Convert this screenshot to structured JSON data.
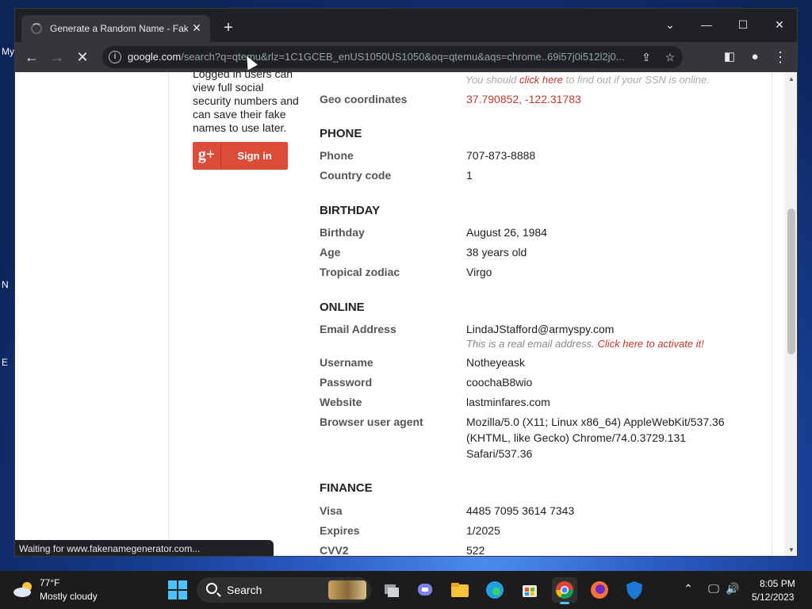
{
  "browser": {
    "tab_title": "Generate a Random Name - Fake Name Generator",
    "newtab": "+",
    "minimize": "—",
    "maximize": "☐",
    "close": "✕",
    "tab_dropdown": "⌄",
    "url_host": "google.com",
    "url_rest": "/search?q=qtemu&rlz=1C1GCEB_enUS1050US1050&oq=qtemu&aqs=chrome..69i57j0i512l2j0...",
    "status": "Waiting for www.fakenamegenerator.com..."
  },
  "sidebar": {
    "text": "Logged in users can view full social security numbers and can save their fake names to use later.",
    "signin": "Sign in",
    "gplus": "g+"
  },
  "top_note": {
    "text": "You should ",
    "link": "click here",
    "rest": " to find out if your SSN is online."
  },
  "rows": {
    "geo_label": "Geo coordinates",
    "geo_value": "37.790852, -122.31783",
    "phone_head": "PHONE",
    "phone_label": "Phone",
    "phone_value": "707-873-8888",
    "cc_label": "Country code",
    "cc_value": "1",
    "birthday_head": "BIRTHDAY",
    "bday_label": "Birthday",
    "bday_value": "August 26, 1984",
    "age_label": "Age",
    "age_value": "38 years old",
    "zodiac_label": "Tropical zodiac",
    "zodiac_value": "Virgo",
    "online_head": "ONLINE",
    "email_label": "Email Address",
    "email_value": "LindaJStafford@armyspy.com",
    "email_note": "This is a real email address. ",
    "email_link": "Click here to activate it!",
    "user_label": "Username",
    "user_value": "Notheyeask",
    "pass_label": "Password",
    "pass_value": "coochaB8wio",
    "web_label": "Website",
    "web_value": "lastminfares.com",
    "ua_label": "Browser user agent",
    "ua_line1": "Mozilla/5.0 (X11; Linux x86_64) AppleWebKit/537.36",
    "ua_line2": "(KHTML, like Gecko) Chrome/74.0.3729.131",
    "ua_line3": "Safari/537.36",
    "finance_head": "FINANCE",
    "visa_label": "Visa",
    "visa_value": "4485 7095 3614 7343",
    "exp_label": "Expires",
    "exp_value": "1/2025",
    "cvv_label": "CVV2",
    "cvv_value": "522"
  },
  "desktop": {
    "label_my": "My",
    "label_n": "N",
    "label_e": "E"
  },
  "taskbar": {
    "temp": "77°F",
    "condition": "Mostly cloudy",
    "search": "Search",
    "time": "8:05 PM",
    "date": "5/12/2023"
  }
}
